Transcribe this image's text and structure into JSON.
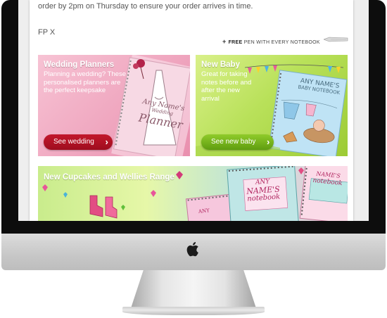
{
  "page": {
    "notice": "order by 2pm on Thursday to ensure your order arrives in time.",
    "code": "FP X",
    "promo": {
      "free": "FREE",
      "rest": "PEN WITH EVERY NOTEBOOK"
    }
  },
  "banners": {
    "wedding": {
      "title": "Wedding Planners",
      "description": "Planning a wedding? These personalised planners are the perfect keepsake",
      "button": "See wedding",
      "cover_line1": "Any Name's",
      "cover_line2": "Wedding",
      "cover_line3": "Planner"
    },
    "baby": {
      "title": "New Baby",
      "description": "Great for taking notes before and after the new arrival",
      "button": "See new baby",
      "cover_line1": "ANY NAME'S",
      "cover_line2": "BABY NOTEBOOK"
    },
    "cupcakes": {
      "title": "New Cupcakes and Wellies Range",
      "cover_a1": "ANY",
      "cover_a2": "NAME'S",
      "cover_a3": "notebook",
      "cover_b1": "ANY",
      "cover_b2": "NAME'S",
      "cover_b3": "notebook"
    }
  },
  "colors": {
    "wedding_button": "#b01226",
    "baby_button": "#76b51c",
    "bezel": "#0d0d0d"
  },
  "icons": {
    "apple": "apple-logo-icon",
    "pen": "pen-icon"
  }
}
